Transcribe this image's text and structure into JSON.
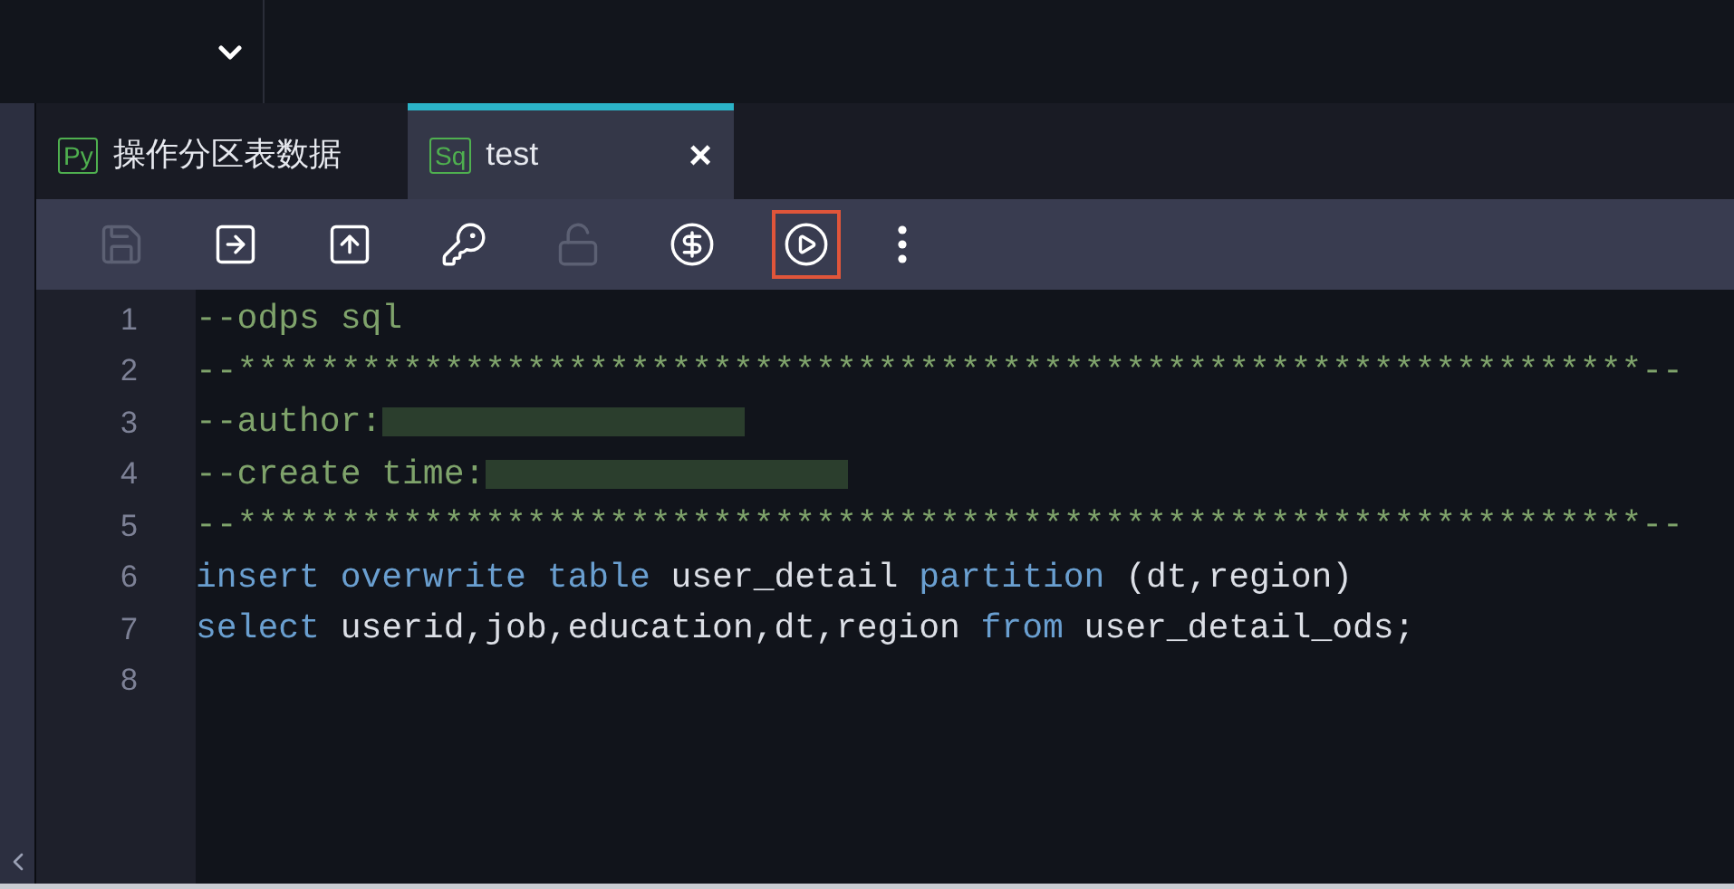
{
  "tabs": [
    {
      "badge": "Py",
      "label": "操作分区表数据",
      "selected": false
    },
    {
      "badge": "Sq",
      "label": "test",
      "selected": true,
      "close": "×"
    }
  ],
  "toolbar": [
    {
      "kind": "save",
      "disabled": true,
      "highlighted": false
    },
    {
      "kind": "save_as",
      "disabled": false,
      "highlighted": false
    },
    {
      "kind": "upload",
      "disabled": false,
      "highlighted": false
    },
    {
      "kind": "key",
      "disabled": false,
      "highlighted": false
    },
    {
      "kind": "lock",
      "disabled": true,
      "highlighted": false
    },
    {
      "kind": "cost",
      "disabled": false,
      "highlighted": false
    },
    {
      "kind": "run",
      "disabled": false,
      "highlighted": true
    },
    {
      "kind": "more",
      "disabled": false,
      "highlighted": false
    }
  ],
  "editor": {
    "lines": [
      {
        "number": "1",
        "tokens": [
          {
            "kind": "comment",
            "text": "--odps sql"
          }
        ]
      },
      {
        "number": "2",
        "tokens": [
          {
            "kind": "comment",
            "text": "--********************************************************************--"
          }
        ]
      },
      {
        "number": "3",
        "tokens": [
          {
            "kind": "comment",
            "text": "--author:"
          },
          {
            "kind": "redacted"
          }
        ]
      },
      {
        "number": "4",
        "tokens": [
          {
            "kind": "comment",
            "text": "--create time:"
          },
          {
            "kind": "redacted"
          }
        ]
      },
      {
        "number": "5",
        "tokens": [
          {
            "kind": "comment",
            "text": "--********************************************************************--"
          }
        ]
      },
      {
        "number": "6",
        "tokens": [
          {
            "kind": "keyword",
            "text": "insert overwrite table"
          },
          {
            "kind": "plain",
            "text": " user_detail "
          },
          {
            "kind": "keyword",
            "text": "partition"
          },
          {
            "kind": "plain",
            "text": " (dt,region)"
          }
        ]
      },
      {
        "number": "7",
        "tokens": [
          {
            "kind": "keyword",
            "text": "select"
          },
          {
            "kind": "plain",
            "text": " userid,job,education,dt,region "
          },
          {
            "kind": "keyword",
            "text": "from"
          },
          {
            "kind": "plain",
            "text": " user_detail_ods;"
          }
        ]
      },
      {
        "number": "8"
      }
    ]
  }
}
